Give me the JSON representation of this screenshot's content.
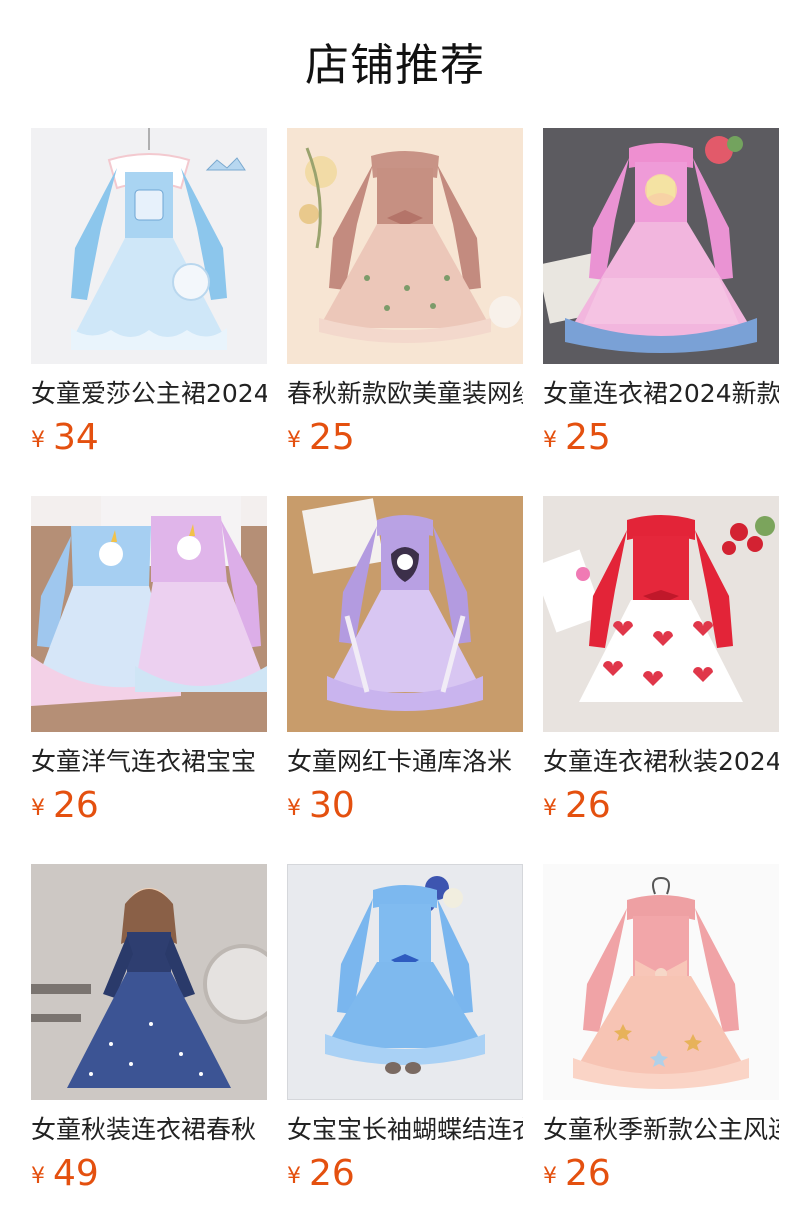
{
  "header": {
    "title": "店铺推荐"
  },
  "currency": "¥",
  "colors": {
    "price": "#e4500f",
    "title": "#111111",
    "name": "#222222"
  },
  "products": [
    {
      "name": "女童爱莎公主裙2024",
      "price": "34",
      "image_icon": "light-blue-princess-dress-image"
    },
    {
      "name": "春秋新款欧美童装网纱",
      "price": "25",
      "image_icon": "pink-bow-dress-image"
    },
    {
      "name": "女童连衣裙2024新款",
      "price": "25",
      "image_icon": "pink-princess-tulle-dress-image"
    },
    {
      "name": "女童洋气连衣裙宝宝",
      "price": "26",
      "image_icon": "unicorn-rainbow-dresses-image"
    },
    {
      "name": "女童网红卡通库洛米",
      "price": "30",
      "image_icon": "purple-kuromi-dress-image"
    },
    {
      "name": "女童连衣裙秋装2024",
      "price": "26",
      "image_icon": "red-heart-tulle-dress-image"
    },
    {
      "name": "女童秋装连衣裙春秋",
      "price": "49",
      "image_icon": "navy-velvet-princess-dress-image"
    },
    {
      "name": "女宝宝长袖蝴蝶结连衣",
      "price": "26",
      "image_icon": "blue-bow-tulle-dress-image"
    },
    {
      "name": "女童秋季新款公主风连",
      "price": "26",
      "image_icon": "peach-bow-tulle-dress-image"
    }
  ]
}
